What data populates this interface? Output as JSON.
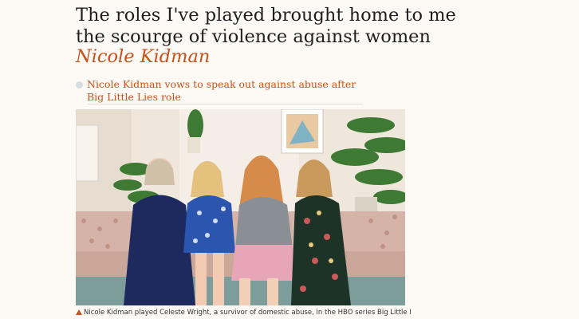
{
  "article": {
    "headline_line1": "The roles I've played brought home to me",
    "headline_line2": "the scourge of violence against women",
    "byline": "Nicole Kidman"
  },
  "related": {
    "link_text": "Nicole Kidman vows to speak out against abuse after Big Little Lies role"
  },
  "photo": {
    "caption": "Nicole Kidman played Celeste Wright, a survivor of domestic abuse, in the HBO series Big Little Lies Photograph:"
  },
  "colors": {
    "accent": "#c4521a",
    "background": "#fdfaf6",
    "text": "#1f1f1f"
  }
}
